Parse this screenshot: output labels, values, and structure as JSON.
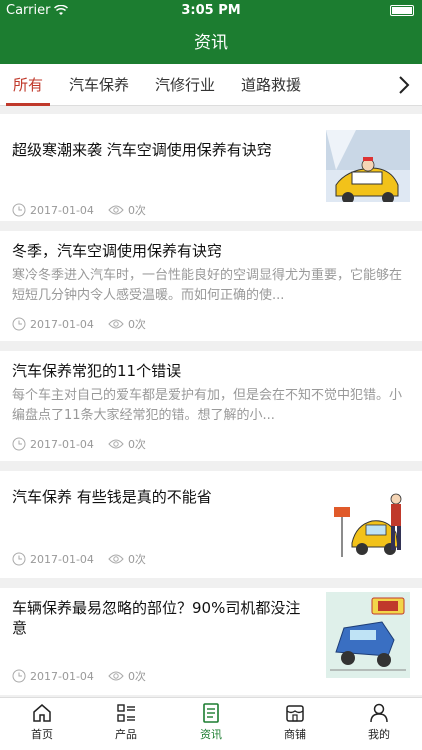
{
  "status": {
    "carrier": "Carrier",
    "time": "3:05 PM"
  },
  "header": {
    "title": "资讯"
  },
  "tabs": [
    {
      "label": "所有"
    },
    {
      "label": "汽车保养"
    },
    {
      "label": "汽修行业"
    },
    {
      "label": "道路救援"
    }
  ],
  "articles": [
    {
      "title": "超级寒潮来袭 汽车空调使用保养有诀窍",
      "summary": "",
      "date": "2017-01-04",
      "views": "0次"
    },
    {
      "title": "冬季，汽车空调使用保养有诀窍",
      "summary": "寒冷冬季进入汽车时，一台性能良好的空调显得尤为重要，它能够在短短几分钟内令人感受温暖。而如何正确的使...",
      "date": "2017-01-04",
      "views": "0次"
    },
    {
      "title": "汽车保养常犯的11个错误",
      "summary": "每个车主对自己的爱车都是爱护有加，但是会在不知不觉中犯错。小编盘点了11条大家经常犯的错。想了解的小...",
      "date": "2017-01-04",
      "views": "0次"
    },
    {
      "title": "汽车保养 有些钱是真的不能省",
      "summary": "",
      "date": "2017-01-04",
      "views": "0次"
    },
    {
      "title": "车辆保养最易忽略的部位？90%司机都没注意",
      "summary": "",
      "date": "2017-01-04",
      "views": "0次"
    }
  ],
  "bottom_nav": [
    {
      "label": "首页",
      "icon": "home-icon"
    },
    {
      "label": "产品",
      "icon": "list-icon"
    },
    {
      "label": "资讯",
      "icon": "news-icon"
    },
    {
      "label": "商铺",
      "icon": "shop-icon"
    },
    {
      "label": "我的",
      "icon": "user-icon"
    }
  ],
  "colors": {
    "brand": "#1c7d30",
    "active_tab": "#c0392b"
  }
}
